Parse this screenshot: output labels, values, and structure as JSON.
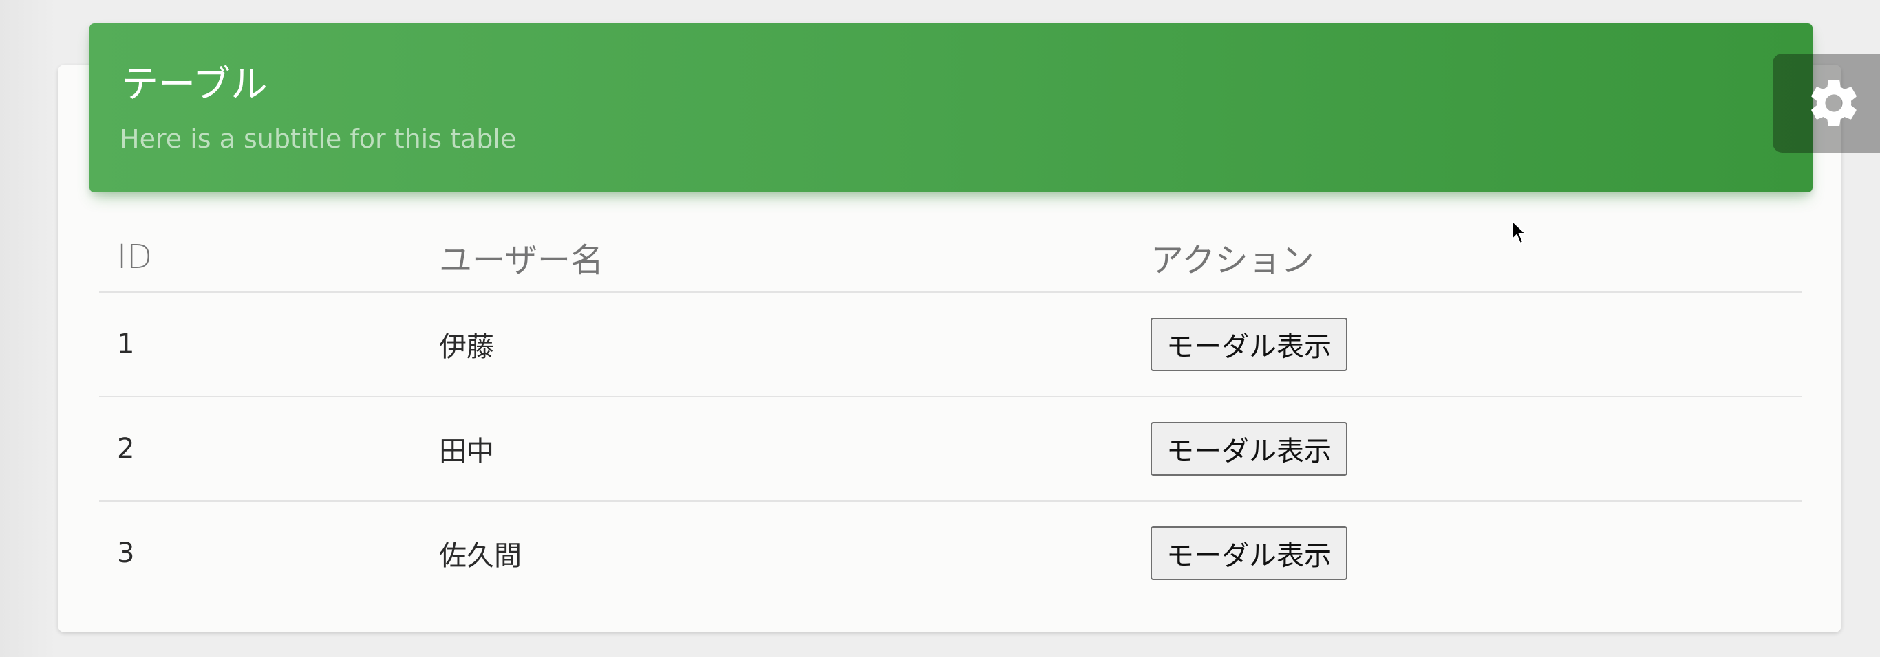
{
  "card": {
    "title": "テーブル",
    "subtitle": "Here is a subtitle for this table"
  },
  "table": {
    "columns": [
      "ID",
      "ユーザー名",
      "アクション"
    ],
    "rows": [
      {
        "id": "1",
        "name": "伊藤",
        "action_label": "モーダル表示"
      },
      {
        "id": "2",
        "name": "田中",
        "action_label": "モーダル表示"
      },
      {
        "id": "3",
        "name": "佐久間",
        "action_label": "モーダル表示"
      }
    ]
  },
  "settings": {
    "icon": "gear-icon"
  },
  "colors": {
    "header_green": "#4caf50",
    "page_background": "#eeeeee",
    "card_background": "#fbfbfa"
  }
}
